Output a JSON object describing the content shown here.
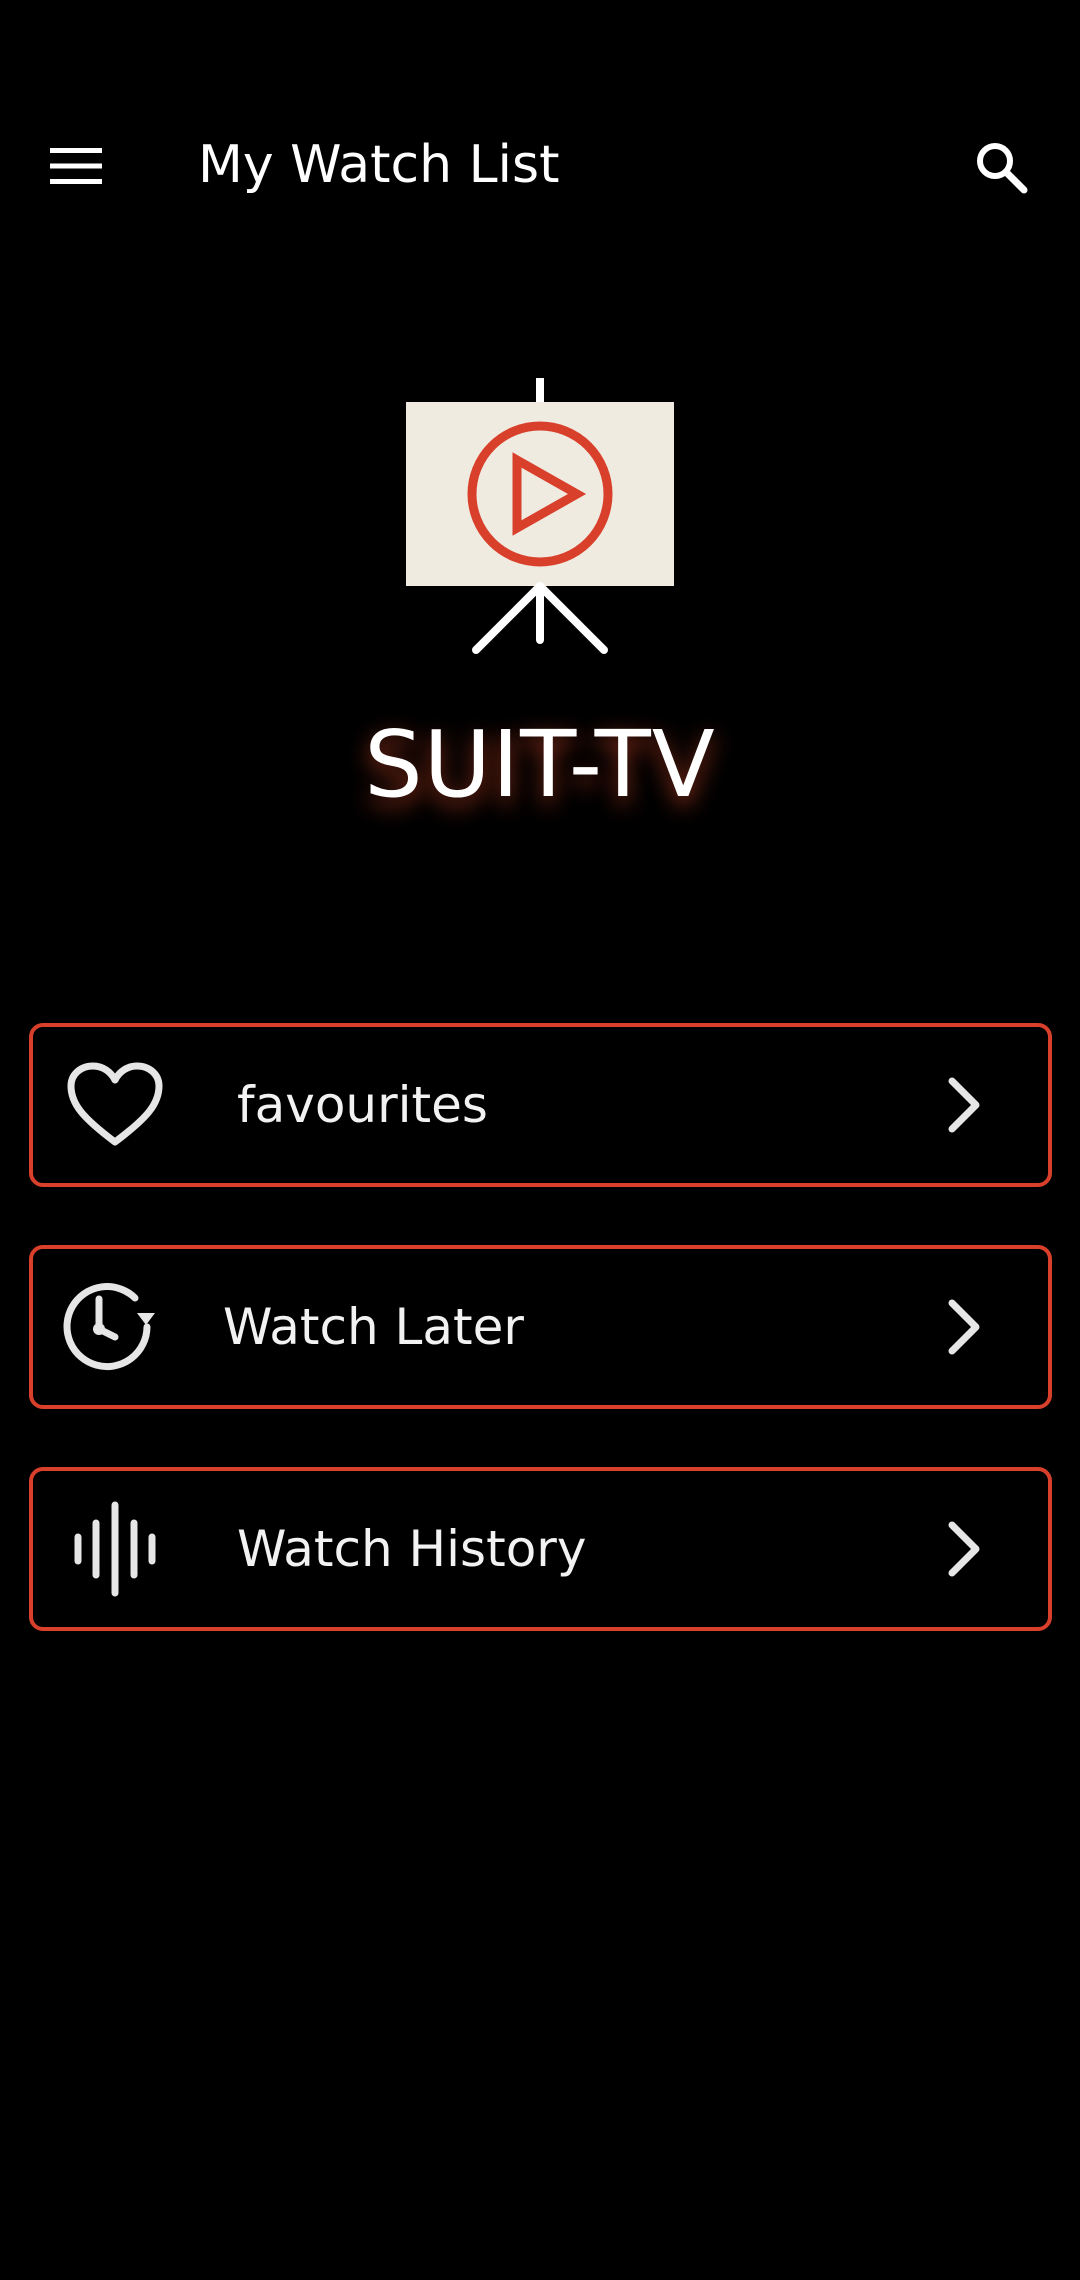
{
  "app_bar": {
    "title": "My Watch List",
    "menu_icon": "hamburger-menu-icon",
    "search_icon": "search-icon"
  },
  "brand": {
    "name": "SUIT-TV",
    "logo_icon": "projector-screen-play-icon"
  },
  "menu": {
    "items": [
      {
        "label": "favourites",
        "icon": "heart-icon"
      },
      {
        "label": "Watch Later",
        "icon": "clock-history-icon"
      },
      {
        "label": "Watch History",
        "icon": "audio-wave-icon"
      }
    ],
    "chevron_icon": "chevron-right-icon"
  },
  "colors": {
    "background": "#000000",
    "accent": "#d9402c",
    "logo_panel": "#efebe0",
    "text": "#ffffff"
  }
}
